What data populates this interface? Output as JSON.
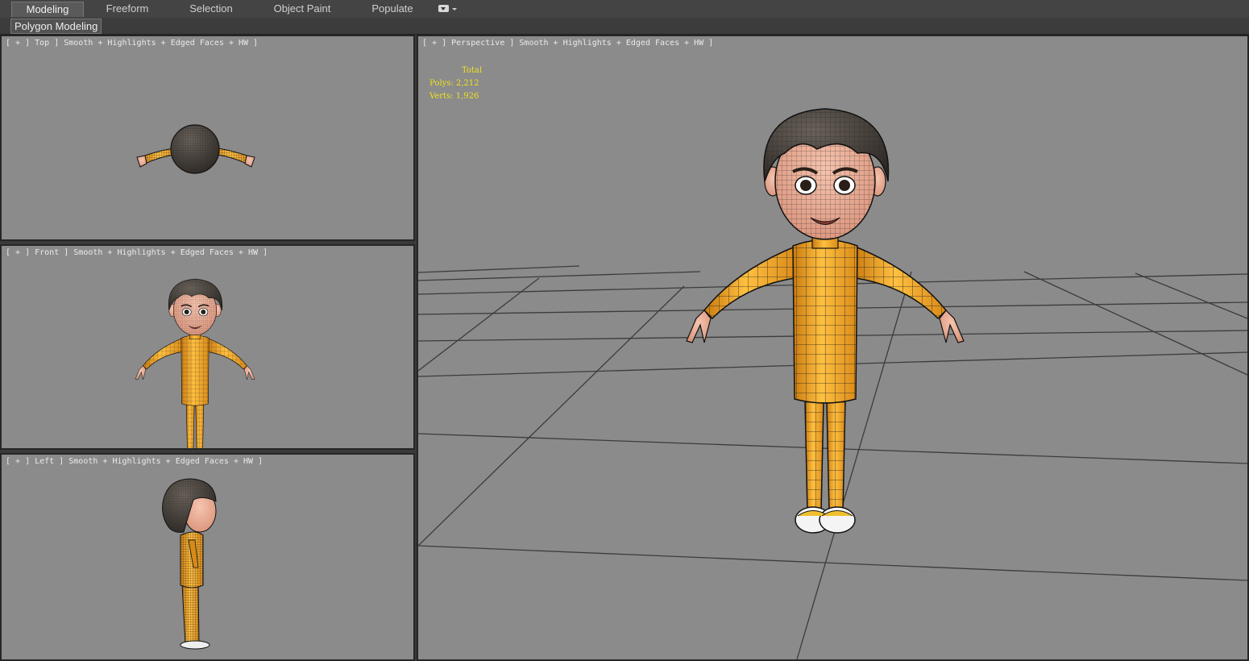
{
  "ribbon": {
    "tabs": [
      {
        "label": "Modeling",
        "active": true
      },
      {
        "label": "Freeform",
        "active": false
      },
      {
        "label": "Selection",
        "active": false
      },
      {
        "label": "Object Paint",
        "active": false
      },
      {
        "label": "Populate",
        "active": false
      }
    ],
    "dropdown_icon": "chevron-down-icon",
    "sub_tab": "Polygon Modeling"
  },
  "viewports": {
    "top": {
      "label": "[ + ] Top ] Smooth + Highlights + Edged Faces + HW ]"
    },
    "front": {
      "label": "[ + ] Front ] Smooth + Highlights + Edged Faces + HW ]"
    },
    "left": {
      "label": "[ + ] Left ] Smooth + Highlights + Edged Faces + HW ]"
    },
    "perspective": {
      "label": "[ + ] Perspective ] Smooth + Highlights + Edged Faces + HW ]",
      "stats": {
        "heading": "Total",
        "polys": "Polys: 2,212",
        "verts": "Verts: 1,926"
      }
    }
  },
  "colors": {
    "viewport_bg": "#8b8b8b",
    "suit": "#f3a520",
    "hair": "#3a3530",
    "skin": "#e8a890",
    "stats_text": "#f0e020"
  }
}
